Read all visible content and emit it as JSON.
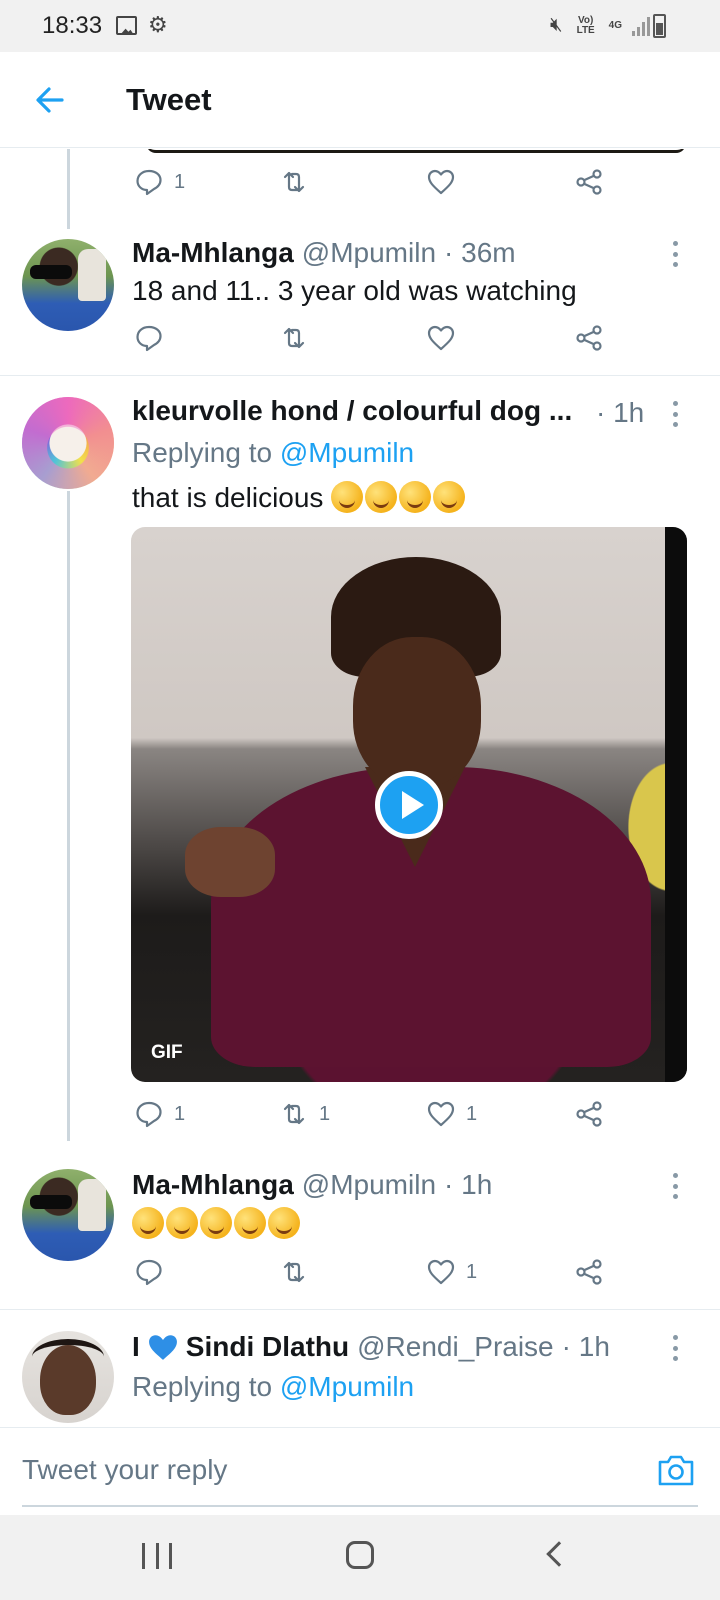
{
  "status_bar": {
    "time": "18:33",
    "network": "4G",
    "volte": "Vo) LTE"
  },
  "header": {
    "title": "Tweet"
  },
  "top_actions": {
    "reply_count": "1"
  },
  "tweets": [
    {
      "name": "Ma-Mhlanga",
      "handle": "@Mpumiln",
      "time": "· 36m",
      "text": "18 and 11.. 3 year old was watching",
      "reply_count": "",
      "retweet_count": "",
      "like_count": ""
    },
    {
      "name": "kleurvolle hond / colourful dog ...",
      "handle": "",
      "time": "· 1h",
      "replying_prefix": "Replying to",
      "replying_to": "@Mpumiln",
      "text": "that is delicious",
      "media_badge": "GIF",
      "reply_count": "1",
      "retweet_count": "1",
      "like_count": "1"
    },
    {
      "name": "Ma-Mhlanga",
      "handle": "@Mpumiln",
      "time": "· 1h",
      "text": "",
      "reply_count": "",
      "retweet_count": "",
      "like_count": "1"
    },
    {
      "name_prefix": "I",
      "name": "Sindi Dlathu",
      "handle": "@Rendi_Praise",
      "time": "· 1h",
      "replying_prefix": "Replying to",
      "replying_to": "@Mpumiln"
    }
  ],
  "reply_bar": {
    "placeholder": "Tweet your reply"
  },
  "colors": {
    "accent": "#1da1f2",
    "secondary_text": "#657786",
    "divider": "#e6ecf0"
  }
}
